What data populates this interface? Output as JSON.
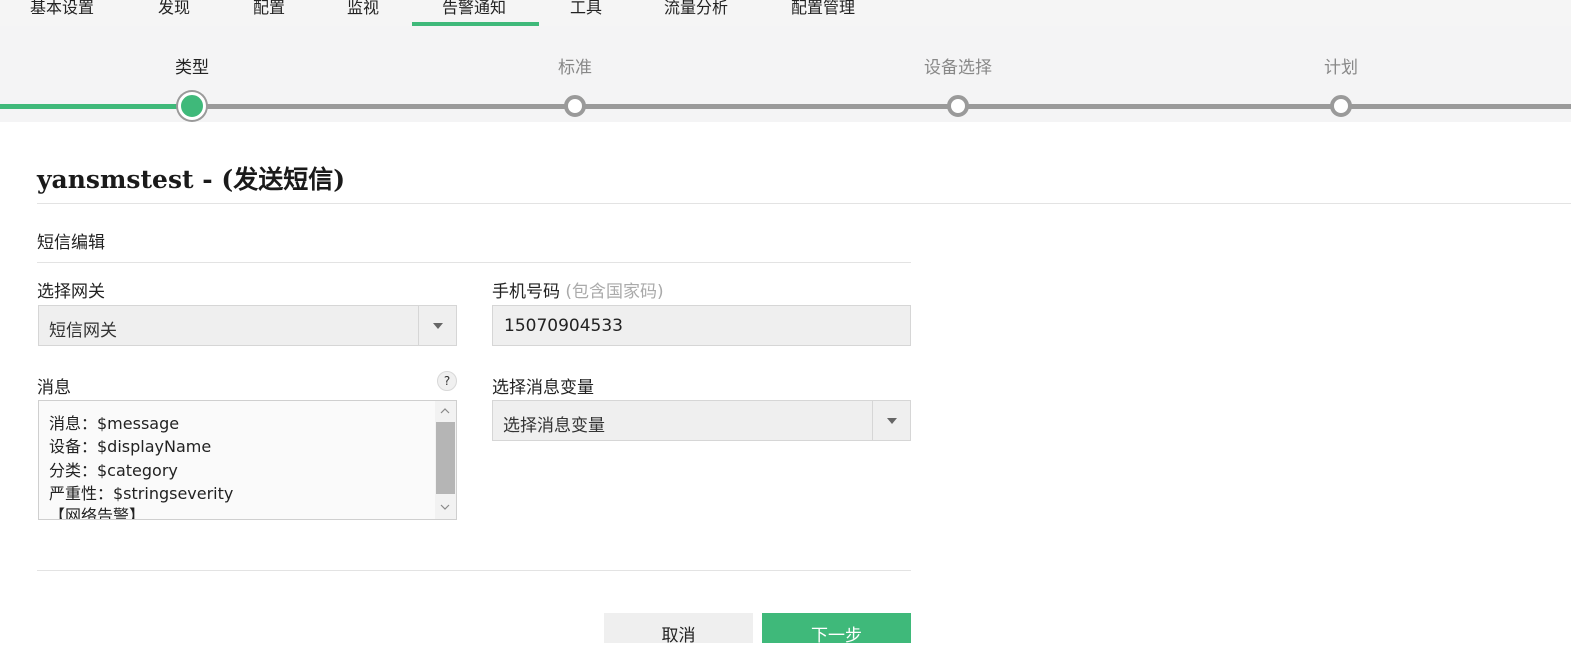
{
  "topnav": {
    "tabs": [
      {
        "label": "基本设置"
      },
      {
        "label": "发现"
      },
      {
        "label": "配置"
      },
      {
        "label": "监视"
      },
      {
        "label": "告警通知",
        "active": true
      },
      {
        "label": "工具"
      },
      {
        "label": "流量分析"
      },
      {
        "label": "配置管理"
      }
    ]
  },
  "stepper": {
    "steps": [
      {
        "label": "类型",
        "active": true
      },
      {
        "label": "标准"
      },
      {
        "label": "设备选择"
      },
      {
        "label": "计划"
      }
    ]
  },
  "page": {
    "title": "yansmstest - (发送短信)",
    "section_title": "短信编辑"
  },
  "form": {
    "gateway": {
      "label": "选择网关",
      "value": "短信网关"
    },
    "phone": {
      "label": "手机号码",
      "hint": "(包含国家码)",
      "value": "15070904533"
    },
    "message": {
      "label": "消息",
      "help": "?",
      "lines": [
        "消息：$message",
        "设备：$displayName",
        "分类：$category",
        "严重性：$stringseverity",
        "【网络告警】"
      ]
    },
    "variable": {
      "label": "选择消息变量",
      "value": "选择消息变量"
    }
  },
  "buttons": {
    "cancel": "取消",
    "next": "下一步"
  },
  "colors": {
    "accent": "#3fb97a",
    "inactive": "#9a9a9a"
  }
}
